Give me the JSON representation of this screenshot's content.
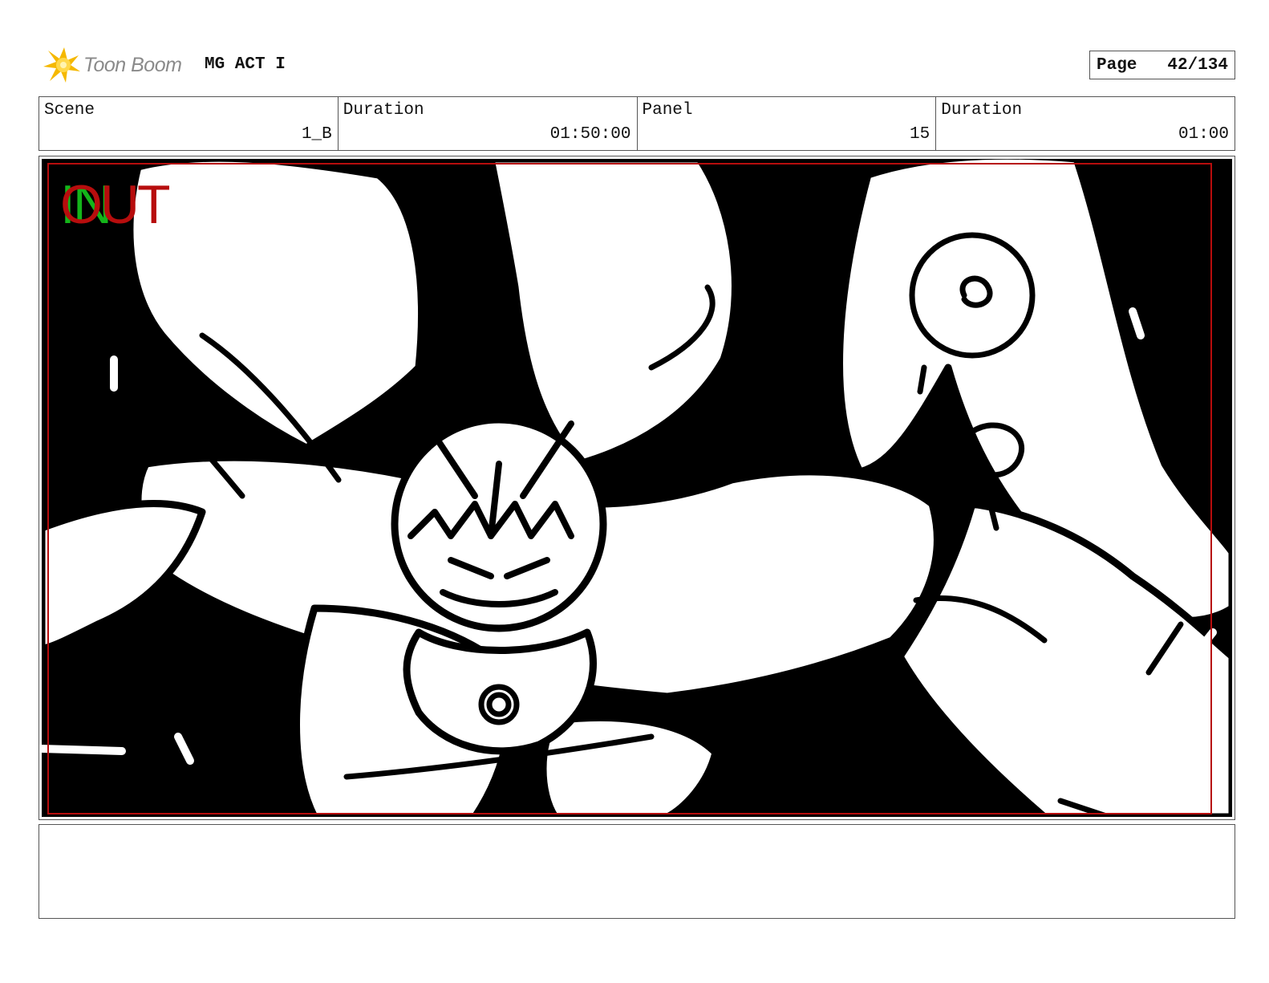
{
  "header": {
    "logo_text": "Toon Boom",
    "project_title": "MG ACT I",
    "page_label": "Page",
    "page_number": "42/134"
  },
  "info": {
    "scene_label": "Scene",
    "scene_value": "1_B",
    "scene_duration_label": "Duration",
    "scene_duration_value": "01:50:00",
    "panel_label": "Panel",
    "panel_value": "15",
    "panel_duration_label": "Duration",
    "panel_duration_value": "01:00"
  },
  "panel": {
    "overlay_in": "IN",
    "overlay_out": "OUT",
    "in_color": "#14b51a",
    "out_color": "#b70d0d",
    "safe_frame_color": "#b70d0d"
  },
  "notes": {
    "text": ""
  }
}
